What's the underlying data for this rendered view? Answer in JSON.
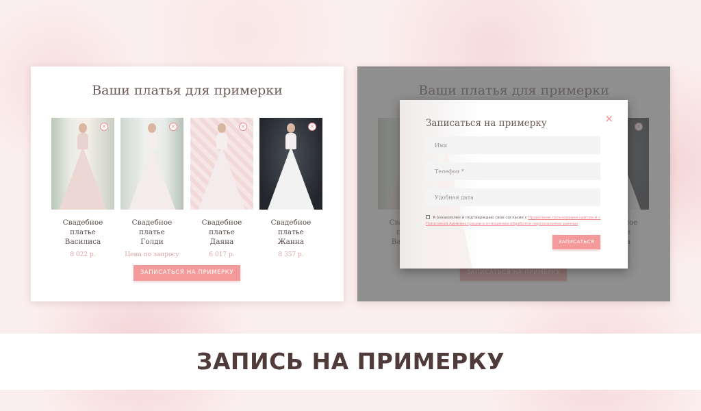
{
  "fitting_list": {
    "title": "Ваши платья для примерки",
    "items": [
      {
        "name_line1": "Свадебное платье",
        "name_line2": "Василиса",
        "price": "8 022 р.",
        "remove": "×"
      },
      {
        "name_line1": "Свадебное платье",
        "name_line2": "Голди",
        "price": "Цена по запросу",
        "remove": "×"
      },
      {
        "name_line1": "Свадебное платье",
        "name_line2": "Даяна",
        "price": "6 017 р.",
        "remove": "×"
      },
      {
        "name_line1": "Свадебное платье",
        "name_line2": "Жанна",
        "price": "8 357 р.",
        "remove": "×"
      }
    ],
    "cta_label": "ЗАПИСАТЬСЯ НА ПРИМЕРКУ"
  },
  "modal": {
    "title": "Записаться на примерку",
    "close": "×",
    "fields": {
      "name_placeholder": "Имя",
      "phone_placeholder": "Телефон *",
      "date_placeholder": "Удобная дата"
    },
    "consent_text": "Я ознакомлен и подтверждаю свое согласие с ",
    "consent_link": "Правилами пользования сайтом и с Политикой Администрации в отношении обработки персональных данных",
    "submit_label": "ЗАПИСАТЬСЯ"
  },
  "banner": {
    "text": "ЗАПИСЬ НА ПРИМЕРКУ"
  },
  "colors": {
    "accent": "#f59a9a",
    "text_dark": "#4f3c3a",
    "price": "#d9a3a3",
    "overlay": "#606060"
  }
}
